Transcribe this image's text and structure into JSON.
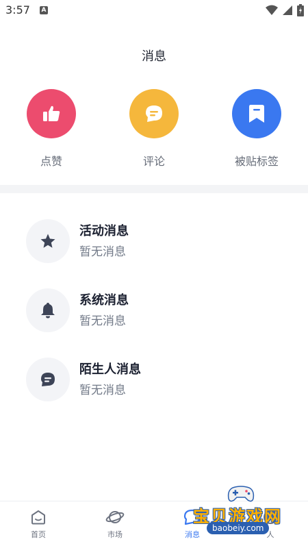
{
  "status_bar": {
    "time": "3:57",
    "notification_badge": "A",
    "icons": [
      "wifi-icon",
      "signal-icon",
      "battery-icon"
    ]
  },
  "page": {
    "title": "消息"
  },
  "actions": [
    {
      "label": "点赞",
      "icon": "thumbs-up-icon",
      "color": "#ec4c6e"
    },
    {
      "label": "评论",
      "icon": "comment-icon",
      "color": "#f5b73c"
    },
    {
      "label": "被贴标签",
      "icon": "bookmark-icon",
      "color": "#3a78f0"
    }
  ],
  "messages": [
    {
      "title": "活动消息",
      "subtitle": "暂无消息",
      "icon": "star-icon"
    },
    {
      "title": "系统消息",
      "subtitle": "暂无消息",
      "icon": "bell-icon"
    },
    {
      "title": "陌生人消息",
      "subtitle": "暂无消息",
      "icon": "chat-icon"
    }
  ],
  "bottom_nav": {
    "active": "消息",
    "active_color": "#3a78f0",
    "tabs": [
      {
        "label": "首页",
        "icon": "home-icon"
      },
      {
        "label": "市场",
        "icon": "planet-icon"
      },
      {
        "label": "消息",
        "icon": "message-icon"
      },
      {
        "label": "人",
        "icon": "person-icon"
      }
    ]
  },
  "watermark": {
    "text": "宝贝游戏网",
    "url": "baobeiy.com"
  }
}
